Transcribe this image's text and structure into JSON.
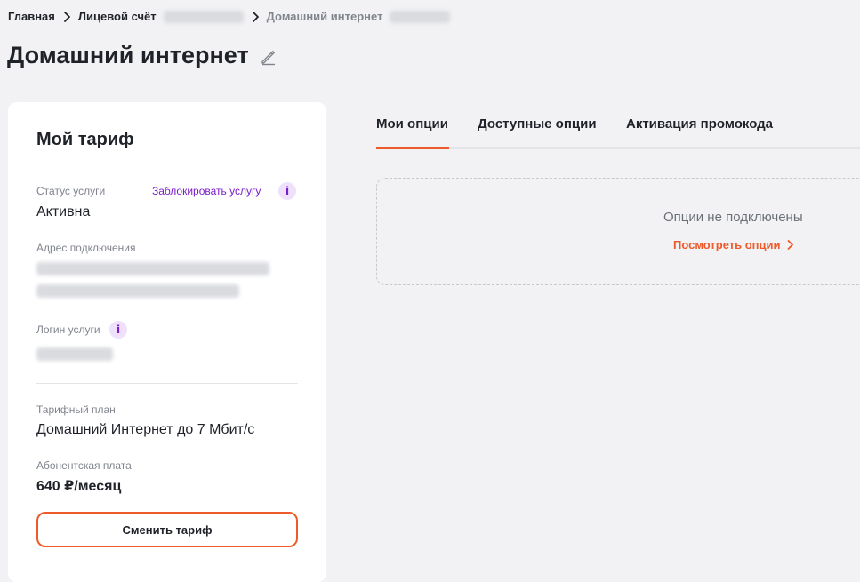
{
  "breadcrumb": {
    "home": "Главная",
    "account": "Лицевой счёт",
    "current": "Домашний интернет"
  },
  "page": {
    "title": "Домашний интернет"
  },
  "tariff_card": {
    "title": "Мой тариф",
    "status_label": "Статус услуги",
    "block_link": "Заблокировать услугу",
    "status_value": "Активна",
    "address_label": "Адрес подключения",
    "login_label": "Логин услуги",
    "plan_label": "Тарифный план",
    "plan_value": "Домашний Интернет до 7 Мбит/с",
    "fee_label": "Абонентская плата",
    "fee_value": "640 ₽/месяц",
    "change_button": "Сменить тариф",
    "info_glyph": "i"
  },
  "tabs": [
    {
      "label": "Мои опции",
      "active": true
    },
    {
      "label": "Доступные опции",
      "active": false
    },
    {
      "label": "Активация промокода",
      "active": false
    }
  ],
  "options_panel": {
    "empty_text": "Опции не подключены",
    "link_text": "Посмотреть опции"
  },
  "colors": {
    "accent": "#ef5a2a",
    "purple": "#7a1fc7",
    "background": "#f2f2f4"
  },
  "icons": {
    "separator": "chevron-right-icon",
    "edit": "pencil-icon",
    "info": "info-icon",
    "link_arrow": "chevron-right-icon"
  }
}
